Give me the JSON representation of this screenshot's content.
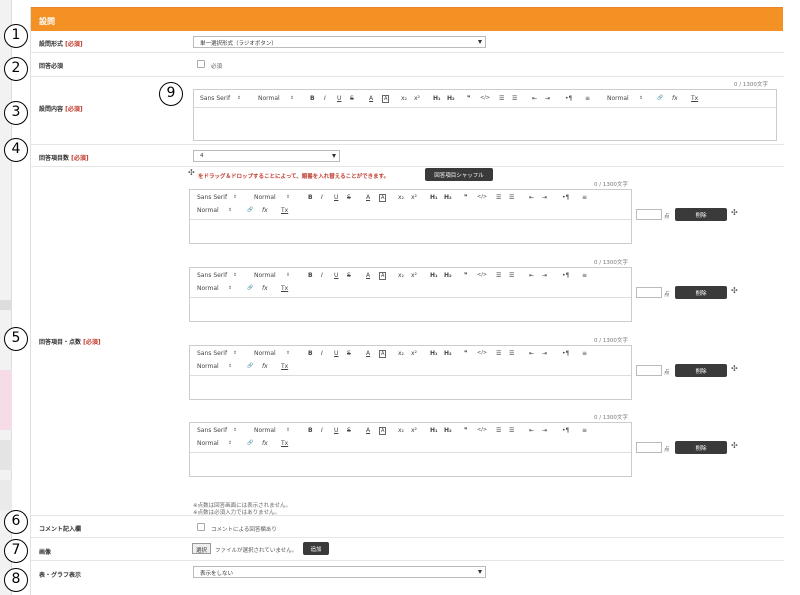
{
  "panel": {
    "title": "設問"
  },
  "rows": {
    "question_type": {
      "label": "設問形式",
      "required": "[必須]",
      "value": "単一選択形式（ラジオボタン）"
    },
    "answer_required": {
      "label": "回答必須",
      "checkbox_label": "必須"
    },
    "content": {
      "label": "設問内容",
      "required": "[必須]",
      "counter": "0 / 1300文字"
    },
    "answer_count": {
      "label": "回答項目数",
      "required": "[必須]",
      "value": "4"
    },
    "answer_items": {
      "label": "回答項目・点数",
      "required": "[必須]"
    },
    "comment": {
      "label": "コメント記入欄",
      "checkbox_label": "コメントによる回答欄あり"
    },
    "image": {
      "label": "画像",
      "file_button": "選択",
      "file_status": "ファイルが選択されていません。",
      "add_button": "追加"
    },
    "graph": {
      "label": "表・グラフ表示",
      "value": "表示をしない"
    }
  },
  "drag_hint": "をドラッグ＆ドロップすることによって、順番を入れ替えることができます。",
  "shuffle_button": "回答項目シャッフル",
  "toolbar": {
    "font": "Sans Serif",
    "size": "Normal",
    "bold": "B",
    "italic": "I",
    "underline": "U",
    "strike": "S",
    "color": "A",
    "bg": "A",
    "sub": "x₂",
    "sup": "x²",
    "h1": "H₁",
    "h2": "H₂",
    "quote": "❞",
    "code": "</>",
    "ol": "☰",
    "ul": "☰",
    "indent_out": "⇤",
    "indent_in": "⇥",
    "dir": "•¶",
    "align": "≡",
    "header": "Normal",
    "link": "🔗",
    "formula": "fx",
    "clean": "Tx"
  },
  "answer_editors": [
    {
      "counter": "0 / 1300文字",
      "points_unit": "点",
      "delete": "削除"
    },
    {
      "counter": "0 / 1300文字",
      "points_unit": "点",
      "delete": "削除"
    },
    {
      "counter": "0 / 1300文字",
      "points_unit": "点",
      "delete": "削除"
    },
    {
      "counter": "0 / 1300文字",
      "points_unit": "点",
      "delete": "削除"
    }
  ],
  "notes": [
    "※点数は回答画面には表示されません。",
    "※点数は必須入力ではありません。"
  ],
  "callouts": [
    "1",
    "2",
    "3",
    "4",
    "5",
    "6",
    "7",
    "8",
    "9"
  ],
  "colors": {
    "header": "#f39125",
    "required": "#c0392b",
    "dark_button": "#3a3a3a"
  }
}
